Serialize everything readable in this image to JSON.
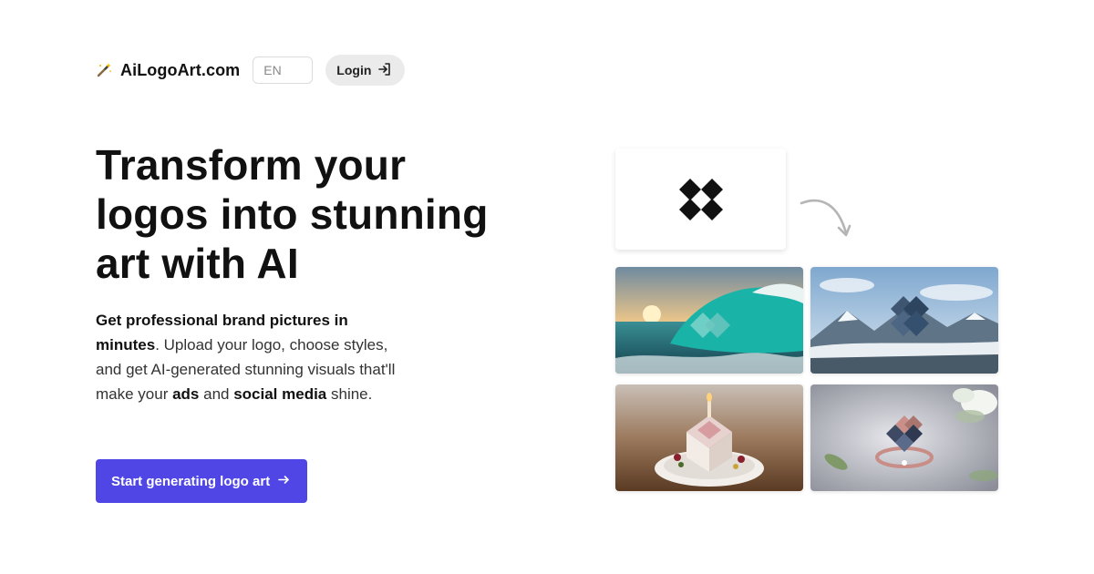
{
  "header": {
    "brand_name": "AiLogoArt.com",
    "language": "EN",
    "login_label": "Login"
  },
  "hero": {
    "headline": "Transform your logos into stunning art with AI",
    "description": [
      {
        "text": "Get professional brand pictures in minutes",
        "bold": true
      },
      {
        "text": ". Upload your logo, choose styles, and get AI-generated stunning visuals that'll make your ",
        "bold": false
      },
      {
        "text": "ads",
        "bold": true
      },
      {
        "text": " and ",
        "bold": false
      },
      {
        "text": "social media",
        "bold": true
      },
      {
        "text": " shine.",
        "bold": false
      }
    ],
    "cta_label": "Start generating logo art"
  },
  "showcase": {
    "examples": [
      "ocean-wave-logo-art",
      "snowy-mountain-logo-art",
      "dessert-cake-logo-art",
      "jewelry-ring-logo-art"
    ]
  },
  "colors": {
    "accent": "#4f46e5",
    "login_bg": "#ebebeb"
  },
  "icons": {
    "brand": "magic-wand-icon",
    "login": "login-arrow-icon",
    "cta": "arrow-right-icon",
    "transform": "curved-arrow-icon"
  }
}
